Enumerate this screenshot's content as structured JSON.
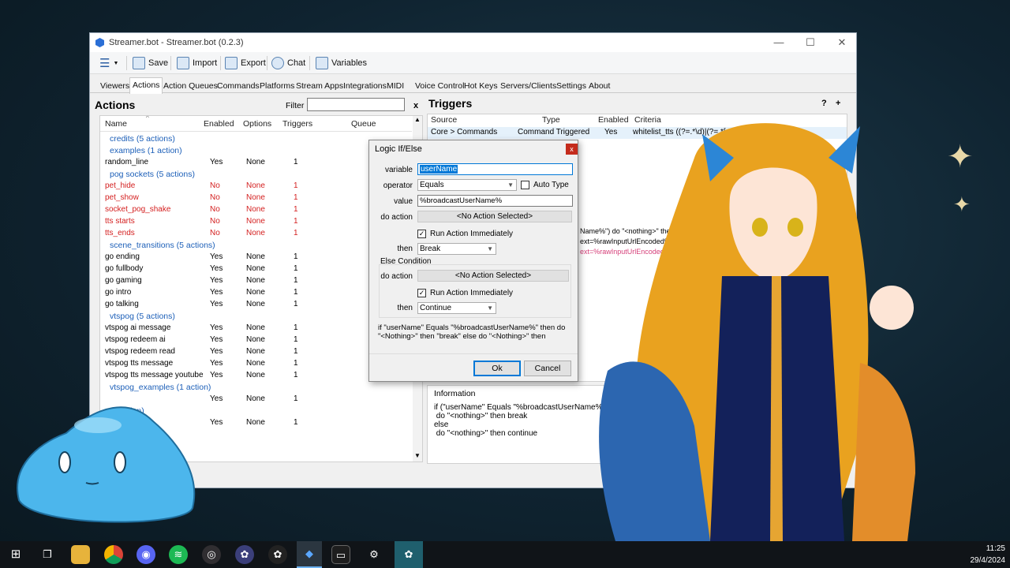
{
  "window": {
    "title": "Streamer.bot - Streamer.bot (0.2.3)"
  },
  "toolbar": {
    "save": "Save",
    "import": "Import",
    "export": "Export",
    "chat": "Chat",
    "variables": "Variables"
  },
  "tabs": [
    "Viewers",
    "Actions",
    "Action Queues",
    "Commands",
    "Platforms",
    "Stream Apps",
    "Integrations",
    "MIDI",
    "Voice Control",
    "Hot Keys",
    "Servers/Clients",
    "Settings",
    "About"
  ],
  "actions": {
    "title": "Actions",
    "filter_label": "Filter",
    "filter_clear": "x",
    "columns": {
      "name": "Name",
      "enabled": "Enabled",
      "options": "Options",
      "triggers": "Triggers",
      "queue": "Queue"
    },
    "rows": [
      {
        "kind": "group",
        "name": "credits (5 actions)"
      },
      {
        "kind": "group",
        "name": "examples (1 action)"
      },
      {
        "kind": "item",
        "name": "random_line",
        "enabled": "Yes",
        "options": "None",
        "triggers": "1",
        "red": false
      },
      {
        "kind": "group",
        "name": "pog sockets (5 actions)"
      },
      {
        "kind": "item",
        "name": "pet_hide",
        "enabled": "No",
        "options": "None",
        "triggers": "1",
        "red": true
      },
      {
        "kind": "item",
        "name": "pet_show",
        "enabled": "No",
        "options": "None",
        "triggers": "1",
        "red": true
      },
      {
        "kind": "item",
        "name": "socket_pog_shake",
        "enabled": "No",
        "options": "None",
        "triggers": "1",
        "red": true
      },
      {
        "kind": "item",
        "name": "tts starts",
        "enabled": "No",
        "options": "None",
        "triggers": "1",
        "red": true
      },
      {
        "kind": "item",
        "name": "tts_ends",
        "enabled": "No",
        "options": "None",
        "triggers": "1",
        "red": true
      },
      {
        "kind": "group",
        "name": "scene_transitions (5 actions)"
      },
      {
        "kind": "item",
        "name": "go ending",
        "enabled": "Yes",
        "options": "None",
        "triggers": "1",
        "red": false
      },
      {
        "kind": "item",
        "name": "go fullbody",
        "enabled": "Yes",
        "options": "None",
        "triggers": "1",
        "red": false
      },
      {
        "kind": "item",
        "name": "go gaming",
        "enabled": "Yes",
        "options": "None",
        "triggers": "1",
        "red": false
      },
      {
        "kind": "item",
        "name": "go intro",
        "enabled": "Yes",
        "options": "None",
        "triggers": "1",
        "red": false
      },
      {
        "kind": "item",
        "name": "go talking",
        "enabled": "Yes",
        "options": "None",
        "triggers": "1",
        "red": false
      },
      {
        "kind": "group",
        "name": "vtspog (5 actions)"
      },
      {
        "kind": "item",
        "name": "vtspog ai message",
        "enabled": "Yes",
        "options": "None",
        "triggers": "1",
        "red": false
      },
      {
        "kind": "item",
        "name": "vtspog redeem ai",
        "enabled": "Yes",
        "options": "None",
        "triggers": "1",
        "red": false
      },
      {
        "kind": "item",
        "name": "vtspog redeem read",
        "enabled": "Yes",
        "options": "None",
        "triggers": "1",
        "red": false
      },
      {
        "kind": "item",
        "name": "vtspog tts message",
        "enabled": "Yes",
        "options": "None",
        "triggers": "1",
        "red": false
      },
      {
        "kind": "item",
        "name": "vtspog tts message youtube",
        "enabled": "Yes",
        "options": "None",
        "triggers": "1",
        "red": false
      },
      {
        "kind": "group",
        "name": "vtspog_examples (1 action)"
      },
      {
        "kind": "item",
        "name": "",
        "enabled": "Yes",
        "options": "None",
        "triggers": "1",
        "red": false
      },
      {
        "kind": "group",
        "name": "(1 action)"
      },
      {
        "kind": "item",
        "name": "",
        "enabled": "Yes",
        "options": "None",
        "triggers": "1",
        "red": false
      }
    ]
  },
  "triggers": {
    "title": "Triggers",
    "help": "?",
    "add": "+",
    "columns": {
      "source": "Source",
      "type": "Type",
      "enabled": "Enabled",
      "criteria": "Criteria"
    },
    "rows": [
      {
        "source": "Core > Commands",
        "type": "Command Triggered",
        "enabled": "Yes",
        "criteria": "whitelist_tts ((?=.*\\d)|(?=.*[a-z])|(?"
      }
    ],
    "subactions": [
      "Name%\") do \"<nothing>\" then \"break\" else do",
      "ext=%rawInputUrlEncoded%&user=%userName%",
      "ext=%rawInputUrlEncoded%&user=%userName%"
    ]
  },
  "information": {
    "title": "Information",
    "body": "if (\"userName\" Equals \"%broadcastUserName%\")\n do \"<nothing>\" then break\nelse\n do \"<nothing>\" then continue"
  },
  "dialog": {
    "title": "Logic If/Else",
    "close": "x",
    "variable_label": "variable",
    "variable_value": "userName",
    "operator_label": "operator",
    "operator_value": "Equals",
    "auto_type": "Auto Type",
    "value_label": "value",
    "value_value": "%broadcastUserName%",
    "do_action_label": "do action",
    "no_action": "<No Action Selected>",
    "run_immediately": "Run Action Immediately",
    "then_label": "then",
    "then_value": "Break",
    "else_condition": "Else Condition",
    "else_do_action_label": "do action",
    "else_no_action": "<No Action Selected>",
    "else_run_immediately": "Run Action Immediately",
    "else_then_label": "then",
    "else_then_value": "Continue",
    "summary": "if \"userName\" Equals \"%broadcastUserName%\" then do \"<Nothing>\" then \"break\" else do \"<Nothing>\" then",
    "ok": "Ok",
    "cancel": "Cancel"
  },
  "taskbar": {
    "time": "11:25",
    "date": "29/4/2024"
  },
  "colors": {
    "accent": "#0078d7",
    "group_blue": "#1c5fb8",
    "disabled_red": "#d42020",
    "close_red": "#c42b1c"
  }
}
